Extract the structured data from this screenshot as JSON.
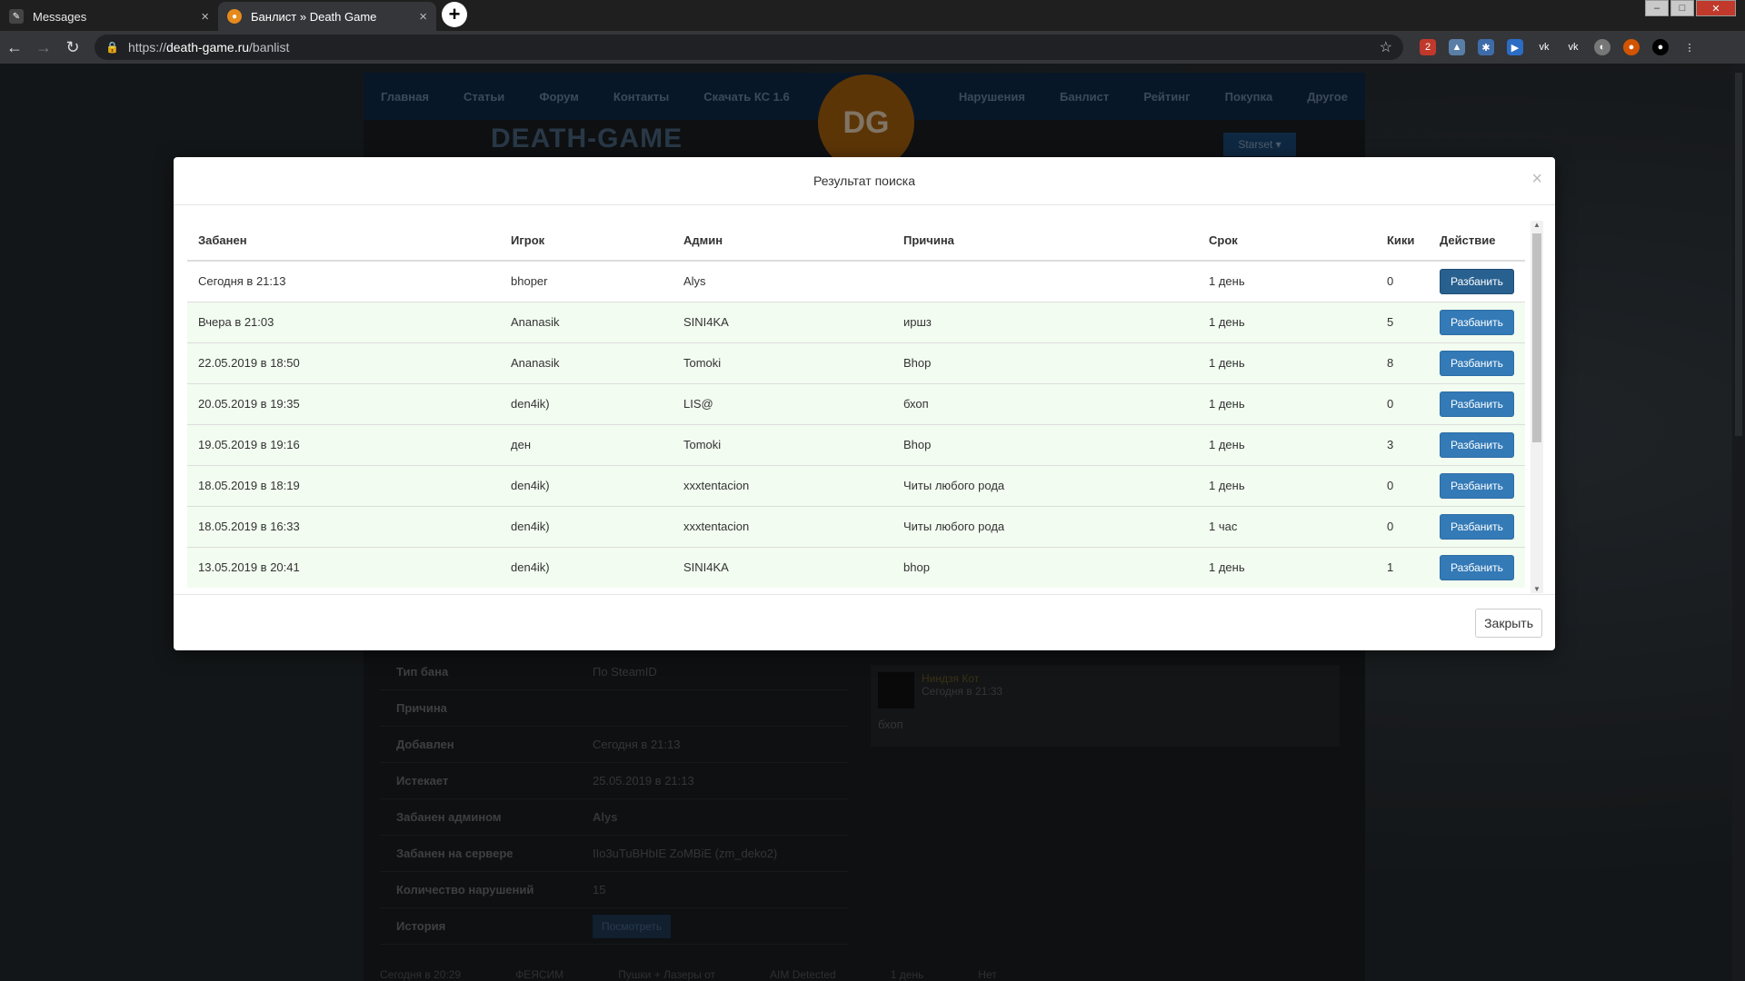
{
  "browser": {
    "tabs": [
      {
        "title": "Messages",
        "active": false
      },
      {
        "title": "Банлист » Death Game",
        "active": true
      }
    ],
    "url_scheme": "https://",
    "url_host": "death-game.ru",
    "url_path": "/banlist"
  },
  "site": {
    "nav": [
      "Главная",
      "Статьи",
      "Форум",
      "Контакты",
      "Скачать КС 1.6",
      "Нарушения",
      "Банлист",
      "Рейтинг",
      "Покупка",
      "Другое"
    ],
    "logo": "DEATH-GAME",
    "badge": "DG",
    "user_name": "Starset ▾",
    "details": [
      {
        "key": "Тип бана",
        "value": "По SteamID"
      },
      {
        "key": "Причина",
        "value": ""
      },
      {
        "key": "Добавлен",
        "value": "Сегодня в 21:13"
      },
      {
        "key": "Истекает",
        "value": "25.05.2019 в 21:13"
      },
      {
        "key": "Забанен админом",
        "value": "Alys"
      },
      {
        "key": "Забанен на сервере",
        "value": "IIo3uTuBHbIE ZoMBiE (zm_deko2)"
      },
      {
        "key": "Количество нарушений",
        "value": "15"
      },
      {
        "key": "История",
        "value": ""
      }
    ],
    "view_button": "Посмотреть",
    "comment": {
      "name": "Ниндзя Кот",
      "time": "Сегодня в 21:33",
      "text": "бхоп"
    },
    "bottom_row": [
      "Сегодня в 20:29",
      "ФЕЯСИМ",
      "Пушки + Лазеры от",
      "AIM Detected",
      "1 день",
      "Нет"
    ]
  },
  "modal": {
    "title": "Результат поиска",
    "close_label": "Закрыть",
    "columns": [
      "Забанен",
      "Игрок",
      "Админ",
      "Причина",
      "Срок",
      "Кики",
      "Действие"
    ],
    "action_label": "Разбанить",
    "rows": [
      {
        "date": "Сегодня в 21:13",
        "player": "bhoper",
        "admin": "Alys",
        "reason": "",
        "term": "1 день",
        "kicks": "0"
      },
      {
        "date": "Вчера в 21:03",
        "player": "Ananasik",
        "admin": "SINI4KA",
        "reason": "иршз",
        "term": "1 день",
        "kicks": "5"
      },
      {
        "date": "22.05.2019 в 18:50",
        "player": "Ananasik",
        "admin": "Tomoki",
        "reason": "Bhop",
        "term": "1 день",
        "kicks": "8"
      },
      {
        "date": "20.05.2019 в 19:35",
        "player": "den4ik)",
        "admin": "LIS@",
        "reason": "бхоп",
        "term": "1 день",
        "kicks": "0"
      },
      {
        "date": "19.05.2019 в 19:16",
        "player": "ден",
        "admin": "Tomoki",
        "reason": "Bhop",
        "term": "1 день",
        "kicks": "3"
      },
      {
        "date": "18.05.2019 в 18:19",
        "player": "den4ik)",
        "admin": "xxxtentacion",
        "reason": "Читы любого рода",
        "term": "1 день",
        "kicks": "0"
      },
      {
        "date": "18.05.2019 в 16:33",
        "player": "den4ik)",
        "admin": "xxxtentacion",
        "reason": "Читы любого рода",
        "term": "1 час",
        "kicks": "0"
      },
      {
        "date": "13.05.2019 в 20:41",
        "player": "den4ik)",
        "admin": "SINI4KA",
        "reason": "bhop",
        "term": "1 день",
        "kicks": "1"
      }
    ]
  }
}
